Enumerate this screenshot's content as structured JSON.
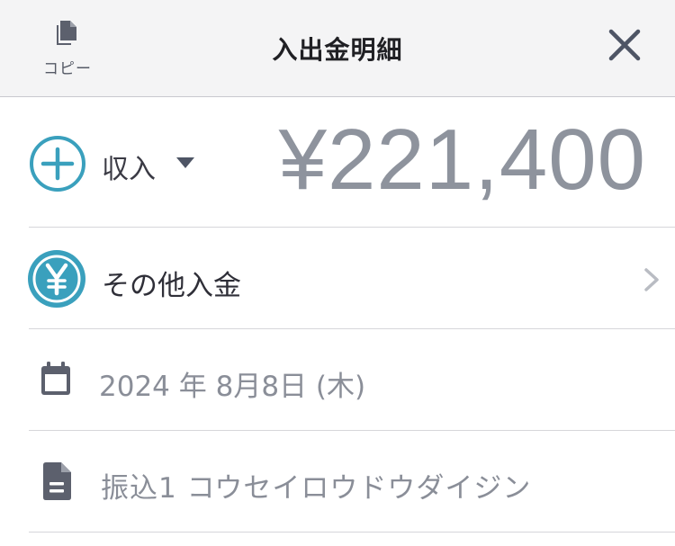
{
  "header": {
    "copy_label": "コピー",
    "title": "入出金明細"
  },
  "entry": {
    "type_label": "収入",
    "amount": "¥221,400"
  },
  "category": {
    "label": "その他入金"
  },
  "date": {
    "text": "2024 年 8月8日 (木)"
  },
  "memo": {
    "text": "振込1 コウセイロウドウダイジン"
  },
  "colors": {
    "accent": "#3aa0bd",
    "header_bg": "#f4f4f5",
    "muted_text": "#8a8e98"
  }
}
